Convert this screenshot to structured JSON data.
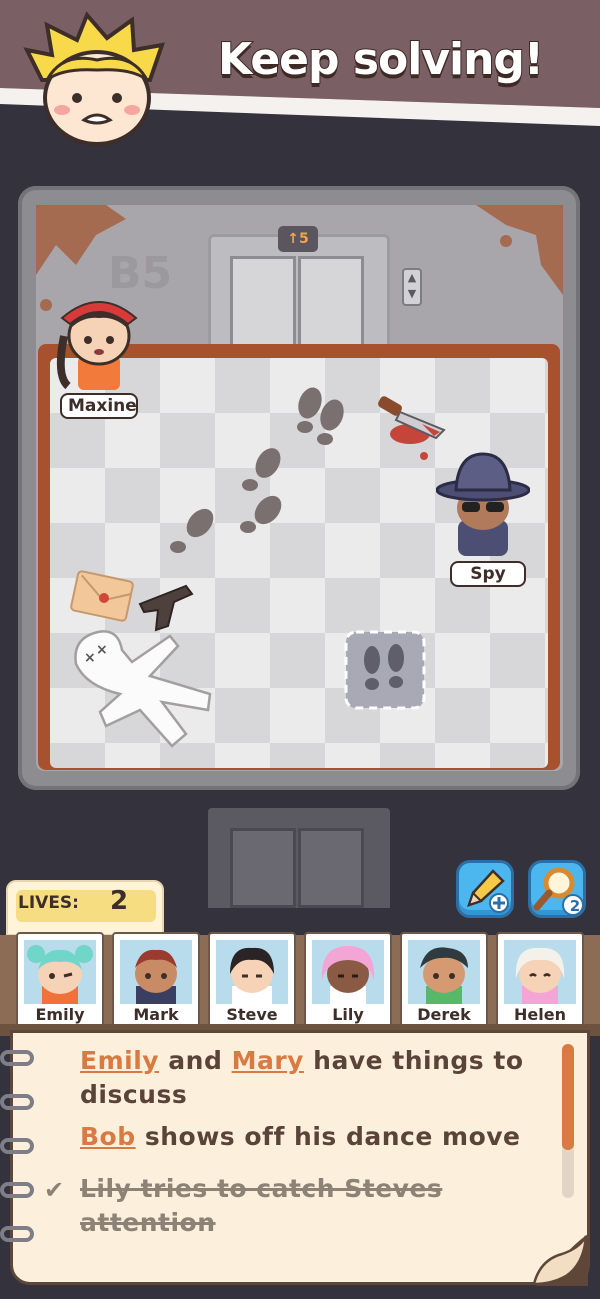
{
  "banner": {
    "title": "Keep solving!"
  },
  "elevator": {
    "floor_indicator": "↑5",
    "floor_label": "B5"
  },
  "characters_on_map": [
    {
      "name": "Maxine"
    },
    {
      "name": "Spy"
    }
  ],
  "tools": {
    "magnifier_count": "2"
  },
  "lives": {
    "label": "LIVES:",
    "value": "2"
  },
  "suspects": [
    {
      "name": "Emily"
    },
    {
      "name": "Mark"
    },
    {
      "name": "Steve"
    },
    {
      "name": "Lily"
    },
    {
      "name": "Derek"
    },
    {
      "name": "Helen"
    }
  ],
  "notes": [
    {
      "name1": "Emily",
      "mid": "and",
      "name2": "Mary",
      "rest1": "have things to",
      "rest2": "discuss",
      "done": false
    },
    {
      "name1": "Bob",
      "rest1": "shows off his dance move",
      "done": false
    },
    {
      "line1": "Lily tries to catch Steves",
      "line2": "attention",
      "done": true
    }
  ],
  "colors": {
    "accent": "#d87a42",
    "frame": "#8c8c91",
    "floor_border": "#a7512f"
  }
}
